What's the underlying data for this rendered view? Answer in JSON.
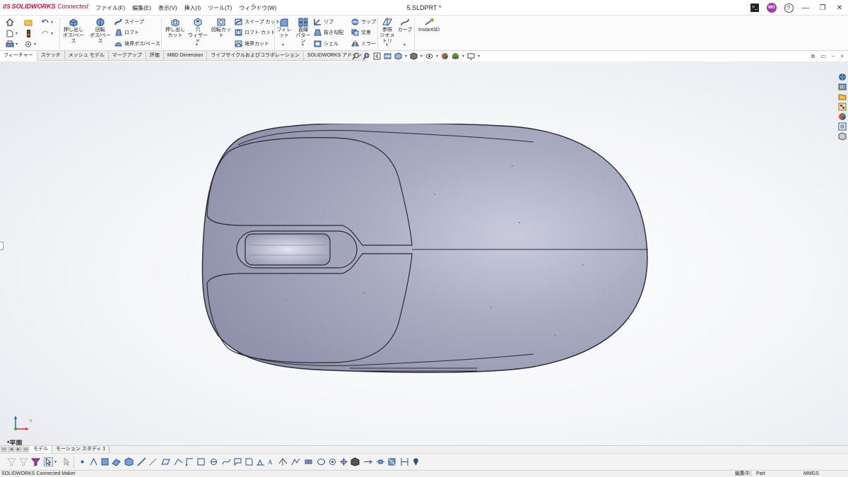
{
  "app": {
    "logo_text": "SOLIDWORKS",
    "logo_suffix": "Connected",
    "document_title": "5.SLDPRT *"
  },
  "menu": [
    "ファイル(F)",
    "編集(E)",
    "表示(V)",
    "挿入(I)",
    "ツール(T)",
    "ウィンドウ(W)"
  ],
  "user": {
    "initials": "MO"
  },
  "ribbon": {
    "extrude_boss_l1": "押し出し",
    "extrude_boss_l2": "ボス/ベース",
    "revolve_boss_l1": "回転",
    "revolve_boss_l2": "ボス/ベース",
    "sweep": "スイープ",
    "loft": "ロフト",
    "boundary_boss": "境界ボス/ベース",
    "extrude_cut_l1": "押し出し",
    "extrude_cut_l2": "カット",
    "hole_wizard_l1": "穴",
    "hole_wizard_l2": "ウィザード",
    "revolve_cut": "回転カット",
    "swept_cut": "スイープ カット",
    "lofted_cut": "ロフト カット",
    "boundary_cut": "境界カット",
    "fillet": "フィレット",
    "linear_pattern_l1": "直線",
    "linear_pattern_l2": "パターン",
    "rib": "リブ",
    "draft": "抜き勾配",
    "shell": "シェル",
    "wrap": "ラップ",
    "intersect": "交差",
    "mirror": "ミラー",
    "ref_geometry_l1": "参照",
    "ref_geometry_l2": "ジオメトリ",
    "curves": "カーブ",
    "instant3d": "Instant3D"
  },
  "command_tabs": [
    "フィーチャー",
    "スケッチ",
    "メッシュ モデル",
    "マークアップ",
    "評価",
    "MBD Dimension",
    "ライフサイクルおよびコラボレーション",
    "SOLIDWORKS アドイン"
  ],
  "viewport": {
    "view_label": "*平面",
    "triad_x": "x"
  },
  "bottom_tabs": [
    "モデル",
    "モーション スタディ 1"
  ],
  "status": {
    "left": "SOLIDWORKS Connected Maker",
    "mode": "編集中： Part",
    "units": "MMGS"
  },
  "colors": {
    "brand": "#c8102e",
    "model_body": "#a7a9bd",
    "model_edge": "#2a2a35",
    "avatar": "#a33ab2"
  }
}
